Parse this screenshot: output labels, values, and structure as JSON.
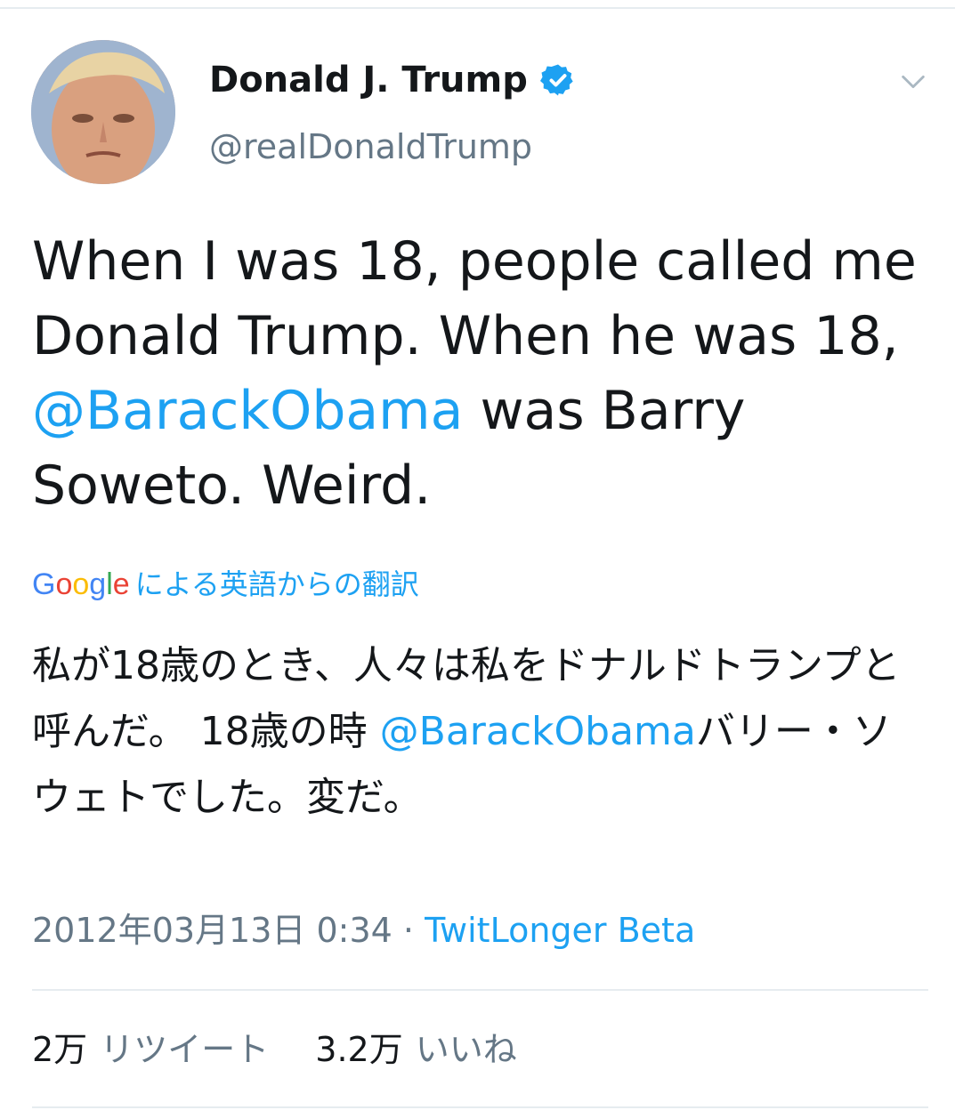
{
  "user": {
    "name": "Donald J. Trump",
    "handle": "@realDonaldTrump",
    "verified": true
  },
  "tweet": {
    "text_before": "When I was 18, people called me Donald Trump. When he was 18, ",
    "mention": "@BarackObama",
    "text_after": " was Barry Soweto. Weird."
  },
  "translation": {
    "provider_letters": [
      "G",
      "o",
      "o",
      "g",
      "l",
      "e"
    ],
    "label": "による英語からの翻訳",
    "text_before": "私が18歳のとき、人々は私をドナルドトランプと呼んだ。 18歳の時 ",
    "mention": "@BarackObama",
    "text_after": "バリー・ソウェトでした。変だ。"
  },
  "meta": {
    "timestamp": "2012年03月13日 0:34",
    "separator": "·",
    "source": "TwitLonger Beta"
  },
  "stats": {
    "retweets_count": "2万",
    "retweets_label": "リツイート",
    "likes_count": "3.2万",
    "likes_label": "いいね"
  },
  "colors": {
    "link": "#1da1f2",
    "secondary_text": "#657786",
    "primary_text": "#14171a",
    "divider": "#e6ecf0"
  },
  "icons": {
    "verified": "verified-badge-icon",
    "menu": "chevron-down-icon"
  }
}
